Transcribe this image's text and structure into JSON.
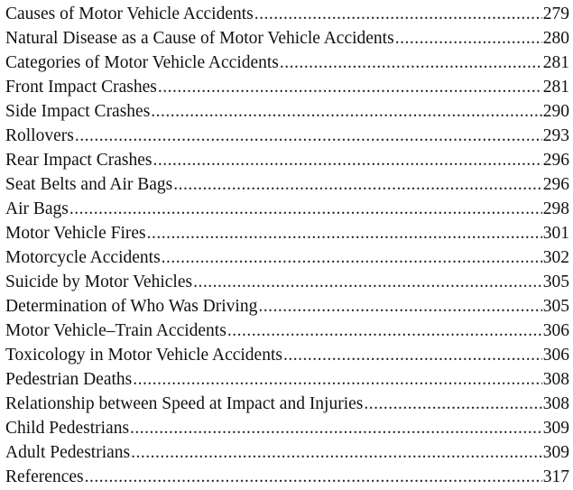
{
  "toc": {
    "entries": [
      {
        "title": "Causes of Motor Vehicle Accidents",
        "page": "279"
      },
      {
        "title": "Natural Disease as a Cause of Motor Vehicle Accidents",
        "page": "280"
      },
      {
        "title": "Categories of Motor Vehicle Accidents",
        "page": "281"
      },
      {
        "title": "Front Impact Crashes",
        "page": "281"
      },
      {
        "title": "Side Impact Crashes",
        "page": "290"
      },
      {
        "title": "Rollovers",
        "page": "293"
      },
      {
        "title": "Rear Impact Crashes",
        "page": "296"
      },
      {
        "title": "Seat Belts and Air Bags",
        "page": "296"
      },
      {
        "title": "Air Bags",
        "page": "298"
      },
      {
        "title": "Motor Vehicle Fires",
        "page": "301"
      },
      {
        "title": "Motorcycle Accidents",
        "page": "302"
      },
      {
        "title": "Suicide by Motor Vehicles",
        "page": "305"
      },
      {
        "title": "Determination of Who Was Driving",
        "page": "305"
      },
      {
        "title": "Motor Vehicle–Train Accidents",
        "page": "306"
      },
      {
        "title": "Toxicology in Motor Vehicle Accidents",
        "page": "306"
      },
      {
        "title": "Pedestrian Deaths",
        "page": "308"
      },
      {
        "title": "Relationship between Speed at Impact and Injuries",
        "page": "308"
      },
      {
        "title": "Child Pedestrians",
        "page": "309"
      },
      {
        "title": "Adult Pedestrians",
        "page": "309"
      },
      {
        "title": "References",
        "page": "317"
      }
    ]
  }
}
